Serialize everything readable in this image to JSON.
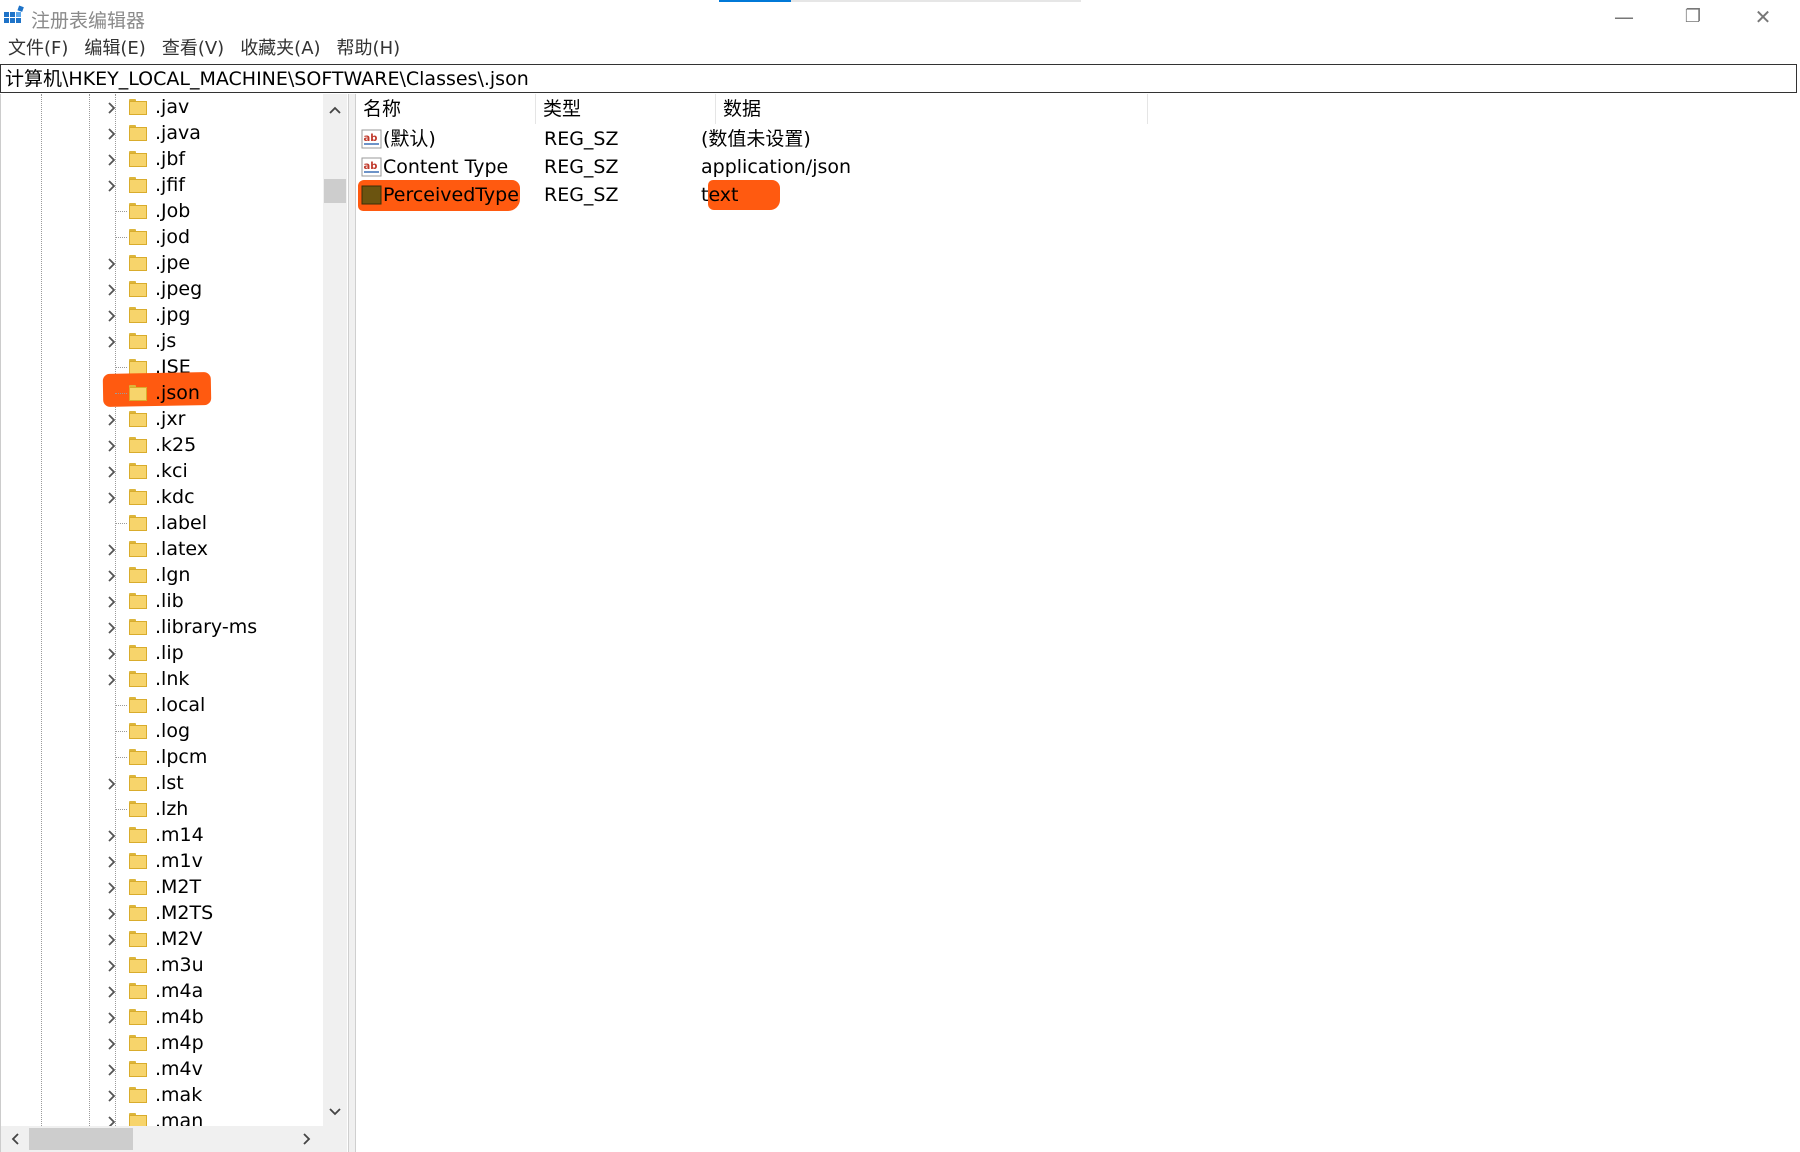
{
  "window": {
    "title": "注册表编辑器",
    "minimize": "—",
    "restore": "❐",
    "close": "✕"
  },
  "menu": [
    "文件(F)",
    "编辑(E)",
    "查看(V)",
    "收藏夹(A)",
    "帮助(H)"
  ],
  "address": "计算机\\HKEY_LOCAL_MACHINE\\SOFTWARE\\Classes\\.json",
  "tree": {
    "items": [
      {
        "label": ".jav",
        "expandable": true
      },
      {
        "label": ".java",
        "expandable": true
      },
      {
        "label": ".jbf",
        "expandable": true
      },
      {
        "label": ".jfif",
        "expandable": true
      },
      {
        "label": ".Job",
        "expandable": false
      },
      {
        "label": ".jod",
        "expandable": false
      },
      {
        "label": ".jpe",
        "expandable": true
      },
      {
        "label": ".jpeg",
        "expandable": true
      },
      {
        "label": ".jpg",
        "expandable": true
      },
      {
        "label": ".js",
        "expandable": true
      },
      {
        "label": ".JSE",
        "expandable": false
      },
      {
        "label": ".json",
        "expandable": false,
        "selected": true
      },
      {
        "label": ".jxr",
        "expandable": true
      },
      {
        "label": ".k25",
        "expandable": true
      },
      {
        "label": ".kci",
        "expandable": true
      },
      {
        "label": ".kdc",
        "expandable": true
      },
      {
        "label": ".label",
        "expandable": false
      },
      {
        "label": ".latex",
        "expandable": true
      },
      {
        "label": ".lgn",
        "expandable": true
      },
      {
        "label": ".lib",
        "expandable": true
      },
      {
        "label": ".library-ms",
        "expandable": true
      },
      {
        "label": ".lip",
        "expandable": true
      },
      {
        "label": ".lnk",
        "expandable": true
      },
      {
        "label": ".local",
        "expandable": false
      },
      {
        "label": ".log",
        "expandable": false
      },
      {
        "label": ".lpcm",
        "expandable": false
      },
      {
        "label": ".lst",
        "expandable": true
      },
      {
        "label": ".lzh",
        "expandable": false
      },
      {
        "label": ".m14",
        "expandable": true
      },
      {
        "label": ".m1v",
        "expandable": true
      },
      {
        "label": ".M2T",
        "expandable": true
      },
      {
        "label": ".M2TS",
        "expandable": true
      },
      {
        "label": ".M2V",
        "expandable": true
      },
      {
        "label": ".m3u",
        "expandable": true
      },
      {
        "label": ".m4a",
        "expandable": true
      },
      {
        "label": ".m4b",
        "expandable": true
      },
      {
        "label": ".m4p",
        "expandable": true
      },
      {
        "label": ".m4v",
        "expandable": true
      },
      {
        "label": ".mak",
        "expandable": true
      },
      {
        "label": ".man",
        "expandable": true
      }
    ]
  },
  "list": {
    "columns": [
      "名称",
      "类型",
      "数据"
    ],
    "rows": [
      {
        "name": "(默认)",
        "type": "REG_SZ",
        "data": "(数值未设置)",
        "icon": "string-value-icon"
      },
      {
        "name": "Content Type",
        "type": "REG_SZ",
        "data": "application/json",
        "icon": "string-value-icon"
      },
      {
        "name": "PerceivedType",
        "type": "REG_SZ",
        "data": "text",
        "icon": "string-value-icon",
        "highlighted": true
      }
    ]
  },
  "colors": {
    "highlight": "#ff5a10",
    "folder": "#f7d46b",
    "accent": "#0078d7"
  }
}
